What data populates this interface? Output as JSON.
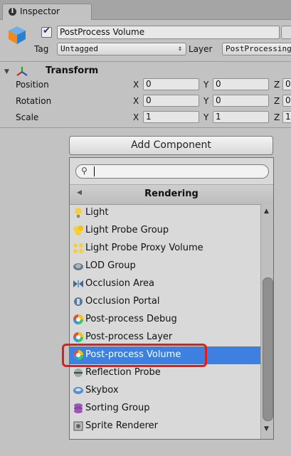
{
  "tab": {
    "label": "Inspector"
  },
  "object": {
    "name": "PostProcess Volume",
    "active": true
  },
  "tag": {
    "label": "Tag",
    "value": "Untagged"
  },
  "layer": {
    "label": "Layer",
    "value": "PostProcessing"
  },
  "transform": {
    "title": "Transform",
    "rows": [
      {
        "label": "Position",
        "x": "0",
        "y": "0",
        "z": "0"
      },
      {
        "label": "Rotation",
        "x": "0",
        "y": "0",
        "z": "0"
      },
      {
        "label": "Scale",
        "x": "1",
        "y": "1",
        "z": "1"
      }
    ],
    "axis": {
      "x": "X",
      "y": "Y",
      "z": "Z"
    }
  },
  "add_component": {
    "label": "Add Component"
  },
  "popup": {
    "search_value": "",
    "category": "Rendering",
    "items": [
      {
        "label": "Light",
        "icon": "light-bulb-icon"
      },
      {
        "label": "Light Probe Group",
        "icon": "light-probe-group-icon"
      },
      {
        "label": "Light Probe Proxy Volume",
        "icon": "light-probe-proxy-icon"
      },
      {
        "label": "LOD Group",
        "icon": "lod-group-icon"
      },
      {
        "label": "Occlusion Area",
        "icon": "occlusion-area-icon"
      },
      {
        "label": "Occlusion Portal",
        "icon": "occlusion-portal-icon"
      },
      {
        "label": "Post-process Debug",
        "icon": "post-process-icon"
      },
      {
        "label": "Post-process Layer",
        "icon": "post-process-icon"
      },
      {
        "label": "Post-process Volume",
        "icon": "post-process-icon",
        "selected": true
      },
      {
        "label": "Reflection Probe",
        "icon": "reflection-probe-icon"
      },
      {
        "label": "Skybox",
        "icon": "skybox-icon"
      },
      {
        "label": "Sorting Group",
        "icon": "sorting-group-icon"
      },
      {
        "label": "Sprite Renderer",
        "icon": "sprite-renderer-icon"
      }
    ]
  },
  "colors": {
    "selection": "#3d80df",
    "highlight_box": "#e01c1c",
    "panel": "#c2c2c2"
  }
}
